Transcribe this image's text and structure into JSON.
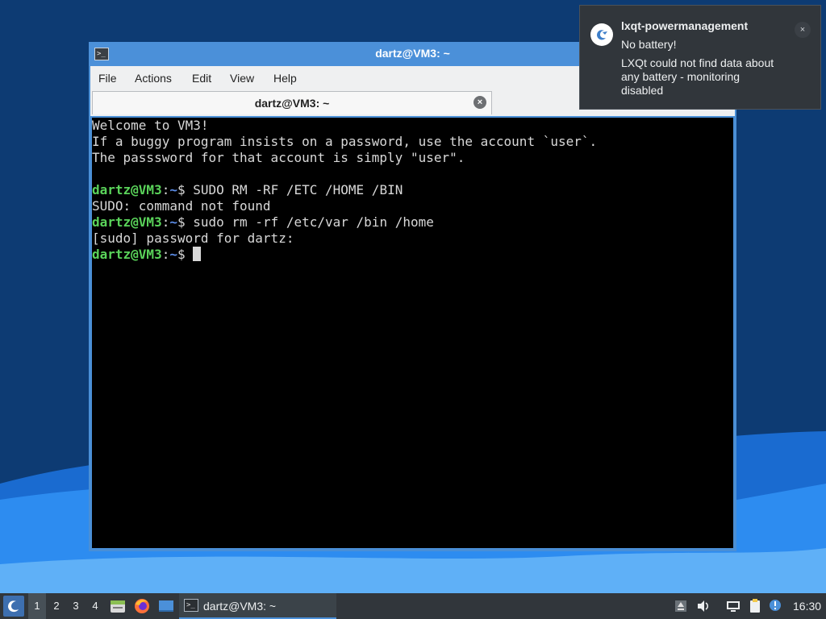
{
  "window": {
    "title": "dartz@VM3: ~",
    "menu": [
      "File",
      "Actions",
      "Edit",
      "View",
      "Help"
    ],
    "tab_label": "dartz@VM3: ~"
  },
  "console": {
    "lines": [
      {
        "type": "text",
        "text": "Welcome to VM3!"
      },
      {
        "type": "text",
        "text": "If a buggy program insists on a password, use the account `user`."
      },
      {
        "type": "text",
        "text": "The passsword for that account is simply \"user\"."
      },
      {
        "type": "text",
        "text": ""
      },
      {
        "type": "prompt",
        "user": "dartz@VM3",
        "path": "~",
        "cmd": "SUDO RM -RF /ETC /HOME /BIN"
      },
      {
        "type": "text",
        "text": "SUDO: command not found"
      },
      {
        "type": "prompt",
        "user": "dartz@VM3",
        "path": "~",
        "cmd": "sudo rm -rf /etc/var /bin /home"
      },
      {
        "type": "text",
        "text": "[sudo] password for dartz:"
      },
      {
        "type": "prompt",
        "user": "dartz@VM3",
        "path": "~",
        "cmd": "",
        "cursor": true
      }
    ]
  },
  "notification": {
    "app": "lxqt-powermanagement",
    "summary": "No battery!",
    "body": "LXQt could not find data about any battery - monitoring disabled",
    "close_label": "×",
    "icon": "lxqt-icon"
  },
  "taskbar": {
    "desktops": [
      "1",
      "2",
      "3",
      "4"
    ],
    "active_desktop": "1",
    "quicklaunch": [
      "file-manager-icon",
      "firefox-icon",
      "show-desktop-icon"
    ],
    "task_label": "dartz@VM3: ~",
    "clock": "16:30",
    "tray": [
      "upload-icon",
      "volume-icon",
      "network-icon",
      "clipboard-icon",
      "update-notifier-icon"
    ]
  },
  "colors": {
    "accent": "#4b90d9",
    "prompt_user": "#5ad35a",
    "prompt_path": "#5c8de8",
    "panel": "#31363b"
  }
}
